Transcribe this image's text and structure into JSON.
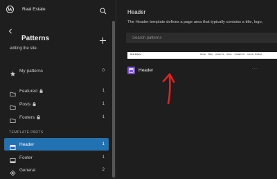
{
  "topbar": {
    "site_title": "Real Estate"
  },
  "sidebar": {
    "title": "Patterns",
    "description": "editing the site.",
    "items": [
      {
        "label": "My patterns",
        "count": "0",
        "icon": "star-icon",
        "locked": false
      },
      {
        "label": "Featured",
        "count": "1",
        "icon": "folder-icon",
        "locked": true
      },
      {
        "label": "Posts",
        "count": "1",
        "icon": "folder-icon",
        "locked": true
      },
      {
        "label": "Footers",
        "count": "1",
        "icon": "folder-icon",
        "locked": true
      }
    ],
    "section_label": "TEMPLATE PARTS",
    "template_parts": [
      {
        "label": "Header",
        "count": "1",
        "icon": "header-icon",
        "active": true
      },
      {
        "label": "Footer",
        "count": "1",
        "icon": "footer-icon",
        "active": false
      },
      {
        "label": "General",
        "count": "2",
        "icon": "diamond-icon",
        "active": false
      }
    ]
  },
  "main": {
    "title": "Header",
    "description": "The Header template defines a page area that typically contains a title, logo,",
    "search_placeholder": "Search patterns",
    "preview": {
      "site": "Real Estate",
      "nav": [
        "Home",
        "Blog",
        "About Us",
        "Store",
        "Contact Us",
        "Home / Product"
      ]
    },
    "pattern": {
      "name": "Header"
    },
    "more_label": "···"
  },
  "colors": {
    "accent": "#2271b1",
    "pattern_icon": "#7b4fd8",
    "arrow": "#e02424"
  }
}
